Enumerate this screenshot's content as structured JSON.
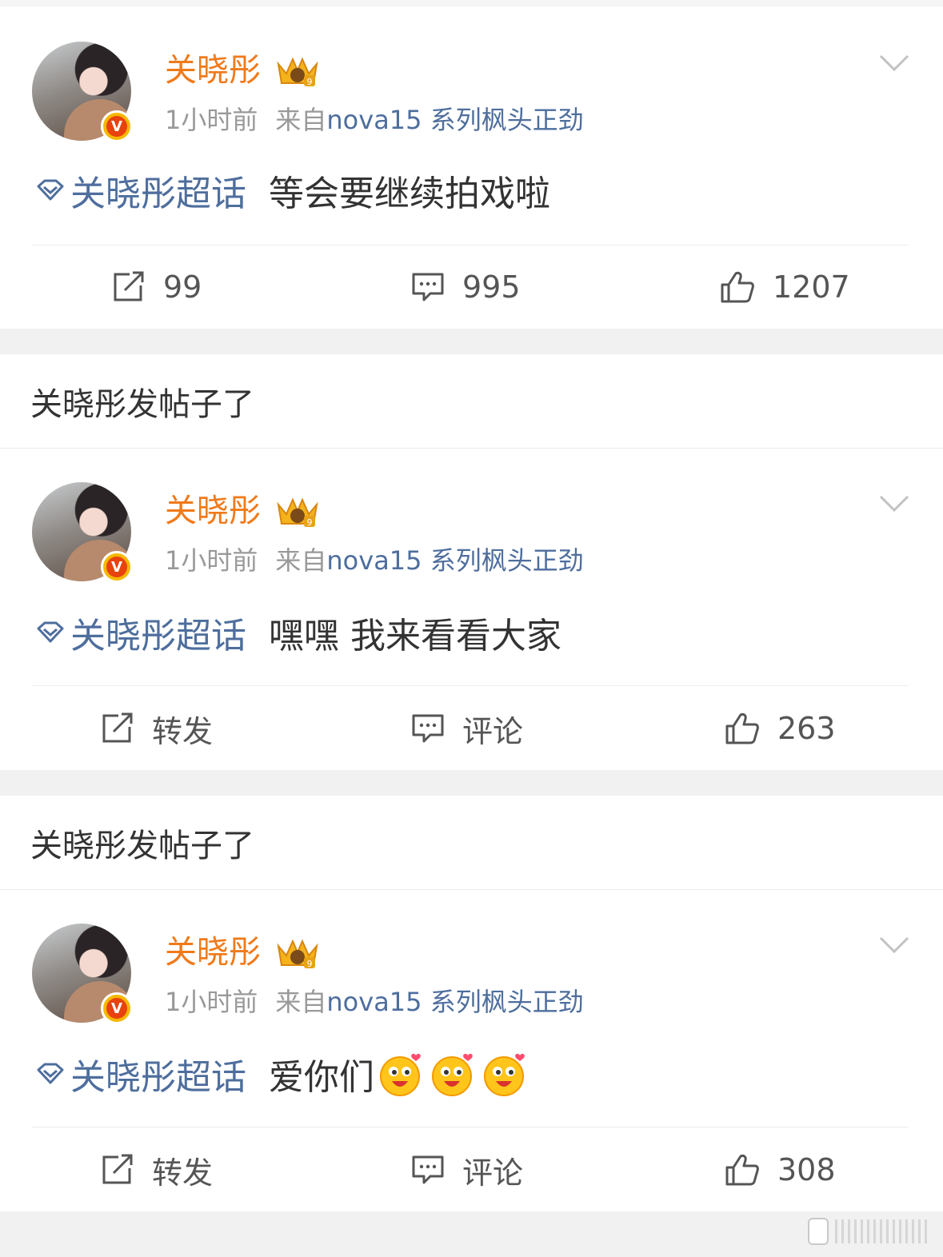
{
  "colors": {
    "username": "#f07a1a",
    "link": "#4e6e9d",
    "meta": "#999999",
    "text": "#333333",
    "background": "#f1f1f1"
  },
  "icons": {
    "topic": "diamond-topic-icon",
    "repost": "repost-icon",
    "comment": "comment-icon",
    "like": "thumbs-up-icon",
    "more": "chevron-down-icon",
    "crown": "vip-crown-icon",
    "verified": "verified-badge-icon"
  },
  "posts": [
    {
      "header": "",
      "user": {
        "name": "关晓彤",
        "verified_mark": "V"
      },
      "meta": {
        "time": "1小时前",
        "from_label": "来自",
        "source": "nova15 系列枫头正劲"
      },
      "topic": "关晓彤超话",
      "text": "等会要继续拍戏啦",
      "emoji_count": 0,
      "actions": {
        "repost": "99",
        "comment": "995",
        "like": "1207"
      }
    },
    {
      "header": "关晓彤发帖子了",
      "user": {
        "name": "关晓彤",
        "verified_mark": "V"
      },
      "meta": {
        "time": "1小时前",
        "from_label": "来自",
        "source": "nova15 系列枫头正劲"
      },
      "topic": "关晓彤超话",
      "text": "嘿嘿 我来看看大家",
      "emoji_count": 0,
      "actions": {
        "repost": "转发",
        "comment": "评论",
        "like": "263"
      }
    },
    {
      "header": "关晓彤发帖子了",
      "user": {
        "name": "关晓彤",
        "verified_mark": "V"
      },
      "meta": {
        "time": "1小时前",
        "from_label": "来自",
        "source": "nova15 系列枫头正劲"
      },
      "topic": "关晓彤超话",
      "text": "爱你们",
      "emoji_count": 3,
      "actions": {
        "repost": "转发",
        "comment": "评论",
        "like": "308"
      }
    }
  ]
}
